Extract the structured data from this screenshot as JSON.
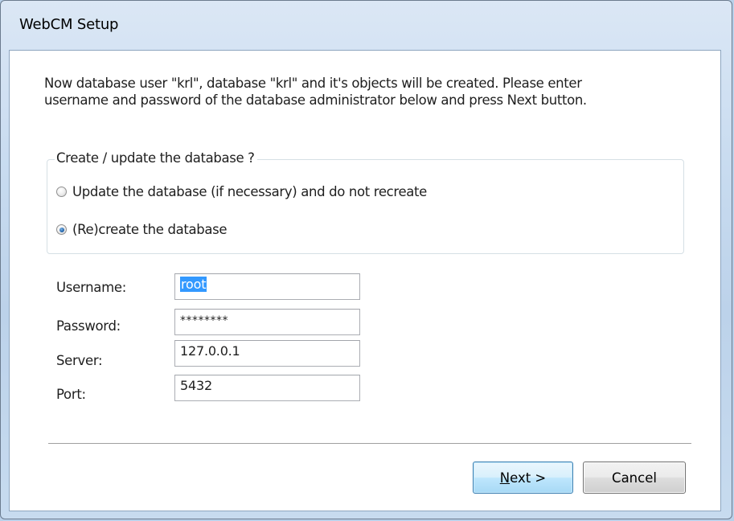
{
  "window": {
    "title": "WebCM Setup"
  },
  "intro": {
    "line1": "Now database user \"krl\", database \"krl\" and it's objects will be created. Please enter",
    "line2": "username and password of the database administrator below and press Next button."
  },
  "group": {
    "legend": "Create / update the database ?",
    "options": [
      {
        "label": "Update the database (if necessary) and do not recreate",
        "checked": false
      },
      {
        "label": "(Re)create the database",
        "checked": true
      }
    ]
  },
  "form": {
    "username": {
      "label": "Username:",
      "value": "root",
      "selected": true
    },
    "password": {
      "label": "Password:",
      "value": "********"
    },
    "server": {
      "label": "Server:",
      "value": "127.0.0.1"
    },
    "port": {
      "label": "Port:",
      "value": "5432"
    }
  },
  "buttons": {
    "next_mnemonic": "N",
    "next_rest": "ext >",
    "cancel": "Cancel"
  },
  "colors": {
    "selection": "#3399ff",
    "frame": "#b9d1ea",
    "default_button_border": "#3c7fb1"
  }
}
